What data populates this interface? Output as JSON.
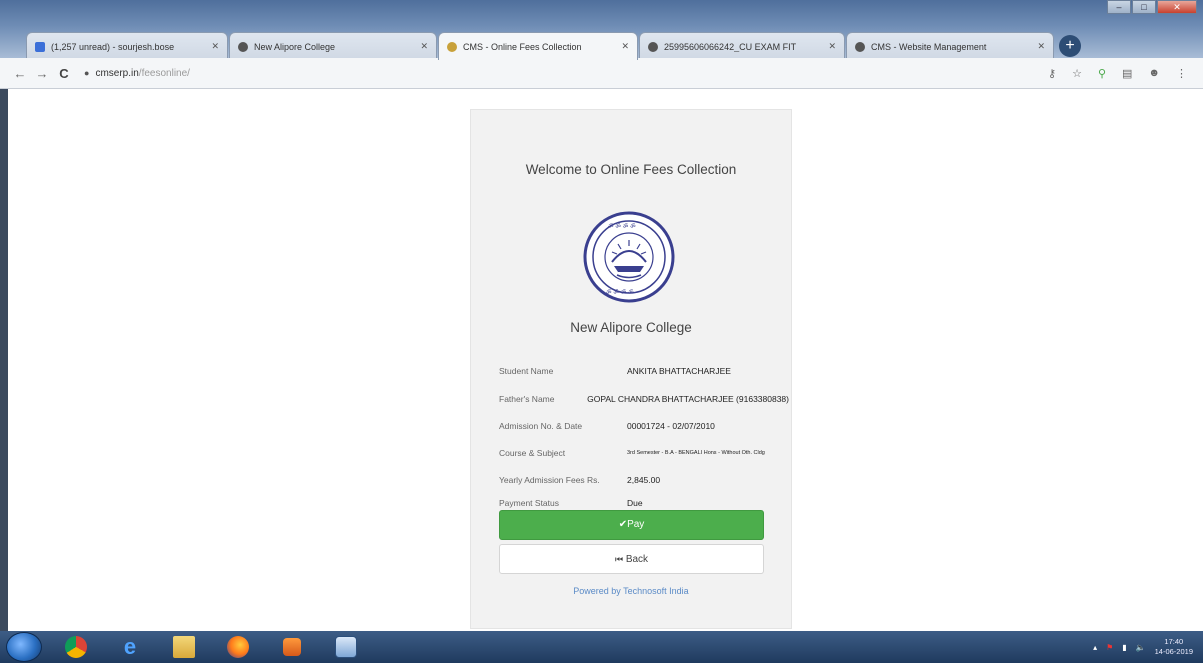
{
  "browser": {
    "tabs": [
      {
        "label": "(1,257 unread) - sourjesh.bose",
        "favicon_color": "#3b6fd8"
      },
      {
        "label": "New Alipore College",
        "favicon_color": "#555555"
      },
      {
        "label": "CMS - Online Fees Collection",
        "favicon_color": "#c8a13a"
      },
      {
        "label": "25995606066242_CU EXAM FIT",
        "favicon_color": "#555555"
      },
      {
        "label": "CMS - Website Management",
        "favicon_color": "#555555"
      }
    ],
    "newtab_label": "+",
    "url_host": "cmserp.in",
    "url_path": "/feesonline/",
    "nav": {
      "back": "←",
      "forward": "→",
      "reload": "C"
    },
    "toolbar_icons": [
      "key-icon",
      "star-icon",
      "search-icon",
      "extension-icon",
      "profile-icon",
      "menu-icon"
    ]
  },
  "card": {
    "title": "Welcome to Online Fees Collection",
    "college_name": "New Alipore College",
    "fields": [
      {
        "label": "Student Name",
        "value": "ANKITA BHATTACHARJEE"
      },
      {
        "label": "Father's Name",
        "value": "GOPAL CHANDRA BHATTACHARJEE (9163380838)"
      },
      {
        "label": "Admission No. & Date",
        "value": "00001724 - 02/07/2010"
      },
      {
        "label": "Course & Subject",
        "value": "3rd Semester - B.A - BENGALI Hons - Without Oth. Cldg"
      },
      {
        "label": "Yearly Admission Fees Rs.",
        "value": "2,845.00"
      },
      {
        "label": "Payment Status",
        "value": "Due"
      }
    ],
    "pay_button": "Pay",
    "back_button": "Back",
    "powered_by": "Powered by Technosoft India"
  },
  "taskbar": {
    "time": "17:40",
    "date": "14-06-2019"
  },
  "colors": {
    "pay_green": "#4cae4c",
    "link_blue": "#5b8bc7"
  }
}
